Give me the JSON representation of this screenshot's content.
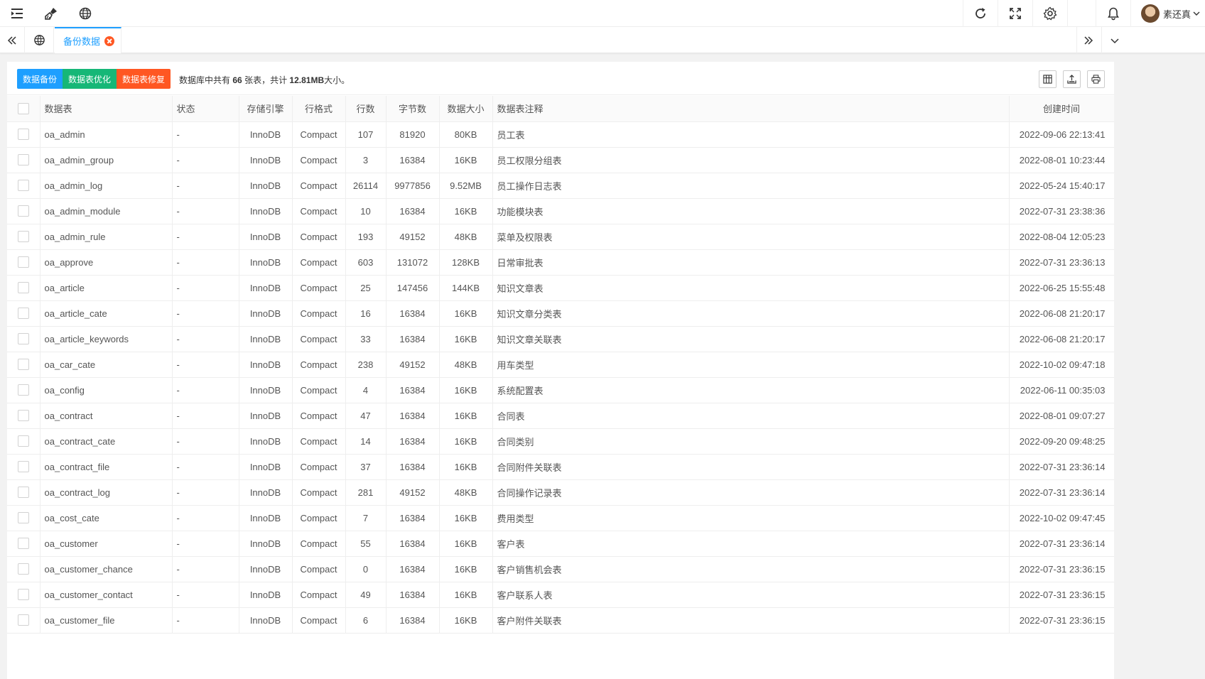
{
  "header": {
    "user_name": "素还真"
  },
  "tabs": {
    "active_label": "备份数据"
  },
  "toolbar": {
    "backup_label": "数据备份",
    "optimize_label": "数据表优化",
    "repair_label": "数据表修复",
    "info_prefix": "数据库中共有",
    "table_count": "66",
    "info_mid": "张表，共计",
    "total_size": "12.81MB",
    "info_suffix": "大小。"
  },
  "table": {
    "headers": [
      "数据表",
      "状态",
      "存储引擎",
      "行格式",
      "行数",
      "字节数",
      "数据大小",
      "数据表注释",
      "创建时间"
    ],
    "rows": [
      [
        "oa_admin",
        "-",
        "InnoDB",
        "Compact",
        "107",
        "81920",
        "80KB",
        "员工表",
        "2022-09-06 22:13:41"
      ],
      [
        "oa_admin_group",
        "-",
        "InnoDB",
        "Compact",
        "3",
        "16384",
        "16KB",
        "员工权限分组表",
        "2022-08-01 10:23:44"
      ],
      [
        "oa_admin_log",
        "-",
        "InnoDB",
        "Compact",
        "26114",
        "9977856",
        "9.52MB",
        "员工操作日志表",
        "2022-05-24 15:40:17"
      ],
      [
        "oa_admin_module",
        "-",
        "InnoDB",
        "Compact",
        "10",
        "16384",
        "16KB",
        "功能模块表",
        "2022-07-31 23:38:36"
      ],
      [
        "oa_admin_rule",
        "-",
        "InnoDB",
        "Compact",
        "193",
        "49152",
        "48KB",
        "菜单及权限表",
        "2022-08-04 12:05:23"
      ],
      [
        "oa_approve",
        "-",
        "InnoDB",
        "Compact",
        "603",
        "131072",
        "128KB",
        "日常审批表",
        "2022-07-31 23:36:13"
      ],
      [
        "oa_article",
        "-",
        "InnoDB",
        "Compact",
        "25",
        "147456",
        "144KB",
        "知识文章表",
        "2022-06-25 15:55:48"
      ],
      [
        "oa_article_cate",
        "-",
        "InnoDB",
        "Compact",
        "16",
        "16384",
        "16KB",
        "知识文章分类表",
        "2022-06-08 21:20:17"
      ],
      [
        "oa_article_keywords",
        "-",
        "InnoDB",
        "Compact",
        "33",
        "16384",
        "16KB",
        "知识文章关联表",
        "2022-06-08 21:20:17"
      ],
      [
        "oa_car_cate",
        "-",
        "InnoDB",
        "Compact",
        "238",
        "49152",
        "48KB",
        "用车类型",
        "2022-10-02 09:47:18"
      ],
      [
        "oa_config",
        "-",
        "InnoDB",
        "Compact",
        "4",
        "16384",
        "16KB",
        "系统配置表",
        "2022-06-11 00:35:03"
      ],
      [
        "oa_contract",
        "-",
        "InnoDB",
        "Compact",
        "47",
        "16384",
        "16KB",
        "合同表",
        "2022-08-01 09:07:27"
      ],
      [
        "oa_contract_cate",
        "-",
        "InnoDB",
        "Compact",
        "14",
        "16384",
        "16KB",
        "合同类别",
        "2022-09-20 09:48:25"
      ],
      [
        "oa_contract_file",
        "-",
        "InnoDB",
        "Compact",
        "37",
        "16384",
        "16KB",
        "合同附件关联表",
        "2022-07-31 23:36:14"
      ],
      [
        "oa_contract_log",
        "-",
        "InnoDB",
        "Compact",
        "281",
        "49152",
        "48KB",
        "合同操作记录表",
        "2022-07-31 23:36:14"
      ],
      [
        "oa_cost_cate",
        "-",
        "InnoDB",
        "Compact",
        "7",
        "16384",
        "16KB",
        "费用类型",
        "2022-10-02 09:47:45"
      ],
      [
        "oa_customer",
        "-",
        "InnoDB",
        "Compact",
        "55",
        "16384",
        "16KB",
        "客户表",
        "2022-07-31 23:36:14"
      ],
      [
        "oa_customer_chance",
        "-",
        "InnoDB",
        "Compact",
        "0",
        "16384",
        "16KB",
        "客户销售机会表",
        "2022-07-31 23:36:15"
      ],
      [
        "oa_customer_contact",
        "-",
        "InnoDB",
        "Compact",
        "49",
        "16384",
        "16KB",
        "客户联系人表",
        "2022-07-31 23:36:15"
      ],
      [
        "oa_customer_file",
        "-",
        "InnoDB",
        "Compact",
        "6",
        "16384",
        "16KB",
        "客户附件关联表",
        "2022-07-31 23:36:15"
      ]
    ]
  },
  "colors": {
    "primary": "#1e9fff",
    "success": "#16b777",
    "danger": "#ff5722"
  }
}
